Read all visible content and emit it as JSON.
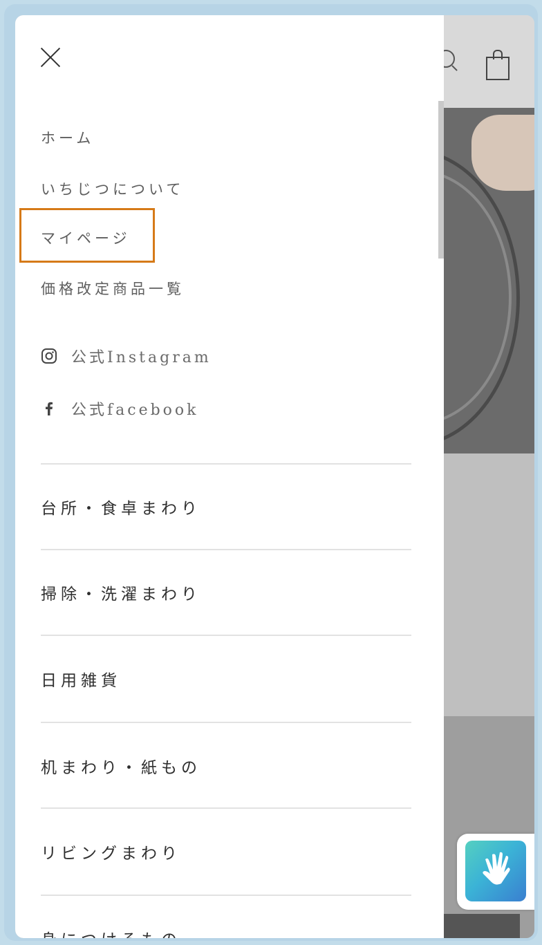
{
  "menu": {
    "links": [
      "ホーム",
      "いちじつについて",
      "マイページ",
      "価格改定商品一覧"
    ],
    "social": [
      {
        "icon": "instagram-icon",
        "label": "公式Instagram"
      },
      {
        "icon": "facebook-icon",
        "label": "公式facebook"
      }
    ],
    "categories": [
      "台所・食卓まわり",
      "掃除・洗濯まわり",
      "日用雑貨",
      "机まわり・紙もの",
      "リビングまわり",
      "身につけるもの"
    ]
  },
  "highlight_color": "#d67a18"
}
